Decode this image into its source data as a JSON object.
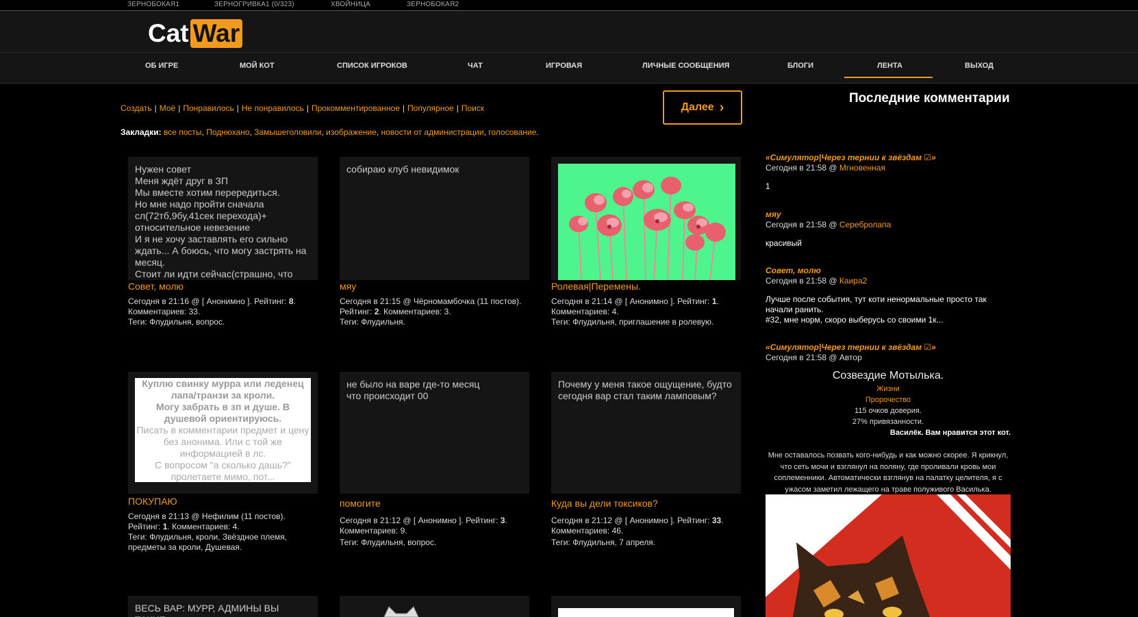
{
  "topbar": [
    "ЗЕРНОБОКАЯ1",
    "ЗЕРНОГРИВКА1 (0/323)",
    "ХВОЙНИЦА",
    "ЗЕРНОБОКАЯ2"
  ],
  "logo": {
    "cat": "Cat",
    "war": "War"
  },
  "nav": [
    "ОБ ИГРЕ",
    "МОЙ КОТ",
    "СПИСОК ИГРОКОВ",
    "ЧАТ",
    "ИГРОВАЯ",
    "ЛИЧНЫЕ СООБЩЕНИЯ",
    "БЛОГИ",
    "ЛЕНТА",
    "ВЫХОД"
  ],
  "nav_active": "ЛЕНТА",
  "links": [
    "Создать",
    "Моё",
    "Понравилось",
    "Не понравилось",
    "Прокомментированное",
    "Популярное",
    "Поиск"
  ],
  "bookmarks": {
    "label": "Закладки:",
    "items": [
      "все посты",
      "Поднюхано",
      "Замышеголовили",
      "изображение",
      "новости от администрации",
      "голосование"
    ]
  },
  "next_button": "Далее",
  "posts": [
    {
      "body": "Нужен совет\nМеня ждёт друг в ЗП\nМы вместе хотим перередиться.\nНо мне надо пройти сначала сл(72тб,9бу,41сек перехода)+ относительное невезение\nИ я не хочу заставлять его сильно ждать... А боюсь, что могу застрять на месяц.\nСтоит ли идти сейчас(страшно, что",
      "title": "Совет, молю",
      "meta1": "Сегодня в 21:16 @ [ Анонимно ]. Рейтинг: ",
      "rating": "8",
      "meta2": "Комментариев: 33.",
      "tags": "Теги: Флудильня, вопрос."
    },
    {
      "body": "собираю клуб невидимок",
      "title": "мяу",
      "meta1": "Сегодня в 21:15 @ Чёрномамбочка (11 постов).",
      "meta2a": "Рейтинг: ",
      "rating": "2",
      "meta2b": ". Комментариев: 3.",
      "tags": "Теги: Флудильня."
    },
    {
      "image": "poppies",
      "title": "Ролевая|Перемены.",
      "meta1": "Сегодня в 21:14 @ [ Анонимно ]. Рейтинг: ",
      "rating": "1",
      "meta2": "Комментариев: 4.",
      "tags": "Теги: Флудильня, приглашение в ролевую."
    },
    {
      "lines_bold": [
        "Куплю свинку мурра или леденец лапа/транзи за кроли.",
        "Могу забрать в зп и душе. В душевой ориентируюсь."
      ],
      "lines": [
        "Писать в комментарии предмет и цену без анонима. Или с той же информацией в лс.",
        "С вопросом \"а сколько дашь?\" пролетаете мимо, пот..."
      ],
      "title": "ПОКУПАЮ",
      "meta1": "Сегодня в 21:13 @ Нефилим (11 постов).",
      "meta2a": "Рейтинг: ",
      "rating": "1",
      "meta2b": ". Комментариев: 4.",
      "tags": "Теги: Флудильня, кроли, Звёздное племя, предметы за кроли, Душевая."
    },
    {
      "body": "не было на варе где-то месяц\nчто происходит 00",
      "title": "помогите",
      "meta1": "Сегодня в 21:12 @ [ Анонимно ]. Рейтинг: ",
      "rating": "3",
      "meta2": "Комментариев: 9.",
      "tags": "Теги: Флудильня, вопрос."
    },
    {
      "body": "Почему у меня такое ощущение, будто сегодня вар стал таким ламповым?",
      "title": "Куда вы дели токсиков?",
      "meta1": "Сегодня в 21:12 @ [ Анонимно ]. Рейтинг: ",
      "rating": "33",
      "meta2": "Комментариев: 46.",
      "tags": "Теги: Флудильня, 7 апреля."
    },
    {
      "body": "ВЕСЬ ВАР: МУРР, АДМИНЫ ВЫ ТАКИЕ"
    }
  ],
  "right": {
    "heading": "Последние комментарии",
    "comments": [
      {
        "title": "«Симулятор|Через тернии к звёздам ☑»",
        "meta": "Сегодня в 21:58 @ ",
        "author": "Мгновенная",
        "text": "1"
      },
      {
        "title": "мяу",
        "meta": "Сегодня в 21:58 @ ",
        "author": "Серебролапа",
        "text": "красивый"
      },
      {
        "title": "Совет, молю",
        "meta": "Сегодня в 21:58 @ ",
        "author": "Каира2",
        "text": "Лучше после события, тут коти ненормальные просто так начали ранить.\n#32, мне норм, скоро выберусь со своими 1к..."
      },
      {
        "title": "«Симулятор|Через тернии к звёздам ☑»",
        "meta": "Сегодня в 21:58 @ Автор"
      }
    ],
    "profile": {
      "name": "Созвездие Мотылька.",
      "link1": "Жизни",
      "link2": "Пророчество",
      "line1": "115 очков доверия.",
      "line2": "27% привязанности.",
      "line3": "Василёк. Вам нравится этот кот."
    },
    "story": "Мне оставалось позвать кого-нибудь и как можно скорее. Я крикнул, что сеть мочи и взглянул на поляну, где проливали кровь мои соплеменники. Автоматически взглянув на палатку целителя, я с ужасом заметил лежащего на траве полуживого Василька."
  },
  "colors": {
    "accent": "#f29a1d",
    "background": "#000000",
    "card": "#151515",
    "poppy_bg": "#4ef58c"
  }
}
